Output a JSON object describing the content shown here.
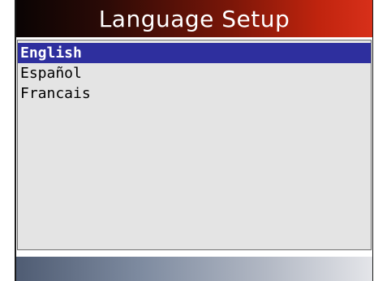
{
  "header": {
    "title": "Language Setup"
  },
  "menu": {
    "items": [
      {
        "label": "English",
        "selected": true
      },
      {
        "label": "Español",
        "selected": false
      },
      {
        "label": "Francais",
        "selected": false
      }
    ]
  },
  "colors": {
    "selection_bg": "#2e2f9e",
    "title_bar_end": "#d8301a",
    "content_bg": "#e4e4e4"
  }
}
